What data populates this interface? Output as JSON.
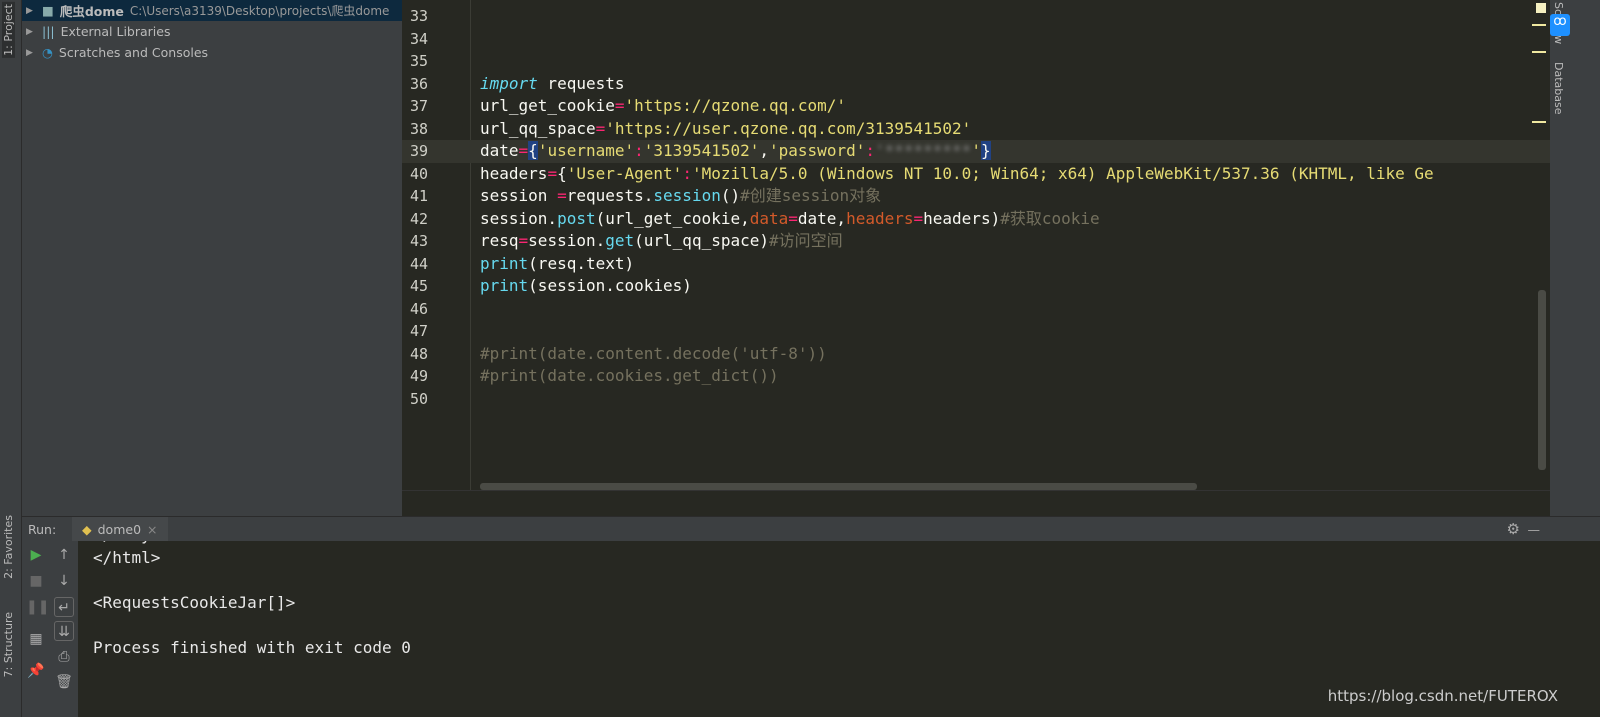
{
  "left_tabs": {
    "project": "1: Project",
    "favorites": "2: Favorites",
    "structure": "7: Structure"
  },
  "project_tree": [
    {
      "name": "爬虫dome",
      "path": "C:\\Users\\a3139\\Desktop\\projects\\爬虫dome",
      "icon": "folder-icon",
      "selected": true
    },
    {
      "name": "External Libraries",
      "icon": "library-icon"
    },
    {
      "name": "Scratches and Consoles",
      "icon": "scratches-icon"
    }
  ],
  "right_tabs": {
    "scview": "SciView",
    "database": "Database"
  },
  "editor": {
    "current_line": 39,
    "lines": [
      {
        "n": "33",
        "t": []
      },
      {
        "n": "34",
        "t": []
      },
      {
        "n": "35",
        "t": []
      },
      {
        "n": "36",
        "t": [
          [
            "import",
            "kw"
          ],
          [
            " requests",
            ""
          ]
        ]
      },
      {
        "n": "37",
        "t": [
          [
            "url_get_cookie",
            ""
          ],
          [
            "=",
            "op"
          ],
          [
            "'https://qzone.qq.com/'",
            "str"
          ]
        ]
      },
      {
        "n": "38",
        "t": [
          [
            "url_qq_space",
            ""
          ],
          [
            "=",
            "op"
          ],
          [
            "'https://user.qzone.qq.com/3139541502'",
            "str"
          ]
        ]
      },
      {
        "n": "39",
        "t": [
          [
            "date",
            ""
          ],
          [
            "=",
            "op"
          ],
          [
            "{",
            "brace"
          ],
          [
            "'username'",
            "str"
          ],
          [
            ":",
            "op"
          ],
          [
            "'3139541502'",
            "str"
          ],
          [
            ",",
            ""
          ],
          [
            "'password'",
            "str"
          ],
          [
            ":",
            "op"
          ],
          [
            "'*********",
            "blur"
          ],
          [
            "'",
            "str"
          ],
          [
            "}",
            "brace"
          ]
        ]
      },
      {
        "n": "40",
        "t": [
          [
            "headers",
            ""
          ],
          [
            "=",
            "op"
          ],
          [
            "{",
            ""
          ],
          [
            "'User-Agent'",
            "str"
          ],
          [
            ":",
            "op"
          ],
          [
            "'Mozilla/5.0 (Windows NT 10.0; Win64; x64) AppleWebKit/537.36 (KHTML, like Ge",
            "str"
          ]
        ]
      },
      {
        "n": "41",
        "t": [
          [
            "session ",
            ""
          ],
          [
            "=",
            "op"
          ],
          [
            "requests.",
            ""
          ],
          [
            "session",
            "fn"
          ],
          [
            "()",
            ""
          ],
          [
            "#创建session对象",
            "cm"
          ]
        ]
      },
      {
        "n": "42",
        "t": [
          [
            "session.",
            ""
          ],
          [
            "post",
            "fn"
          ],
          [
            "(url_get_cookie,",
            ""
          ],
          [
            "data",
            "par"
          ],
          [
            "=",
            "op"
          ],
          [
            "date,",
            ""
          ],
          [
            "headers",
            "par"
          ],
          [
            "=",
            "op"
          ],
          [
            "headers)",
            ""
          ],
          [
            "#获取cookie",
            "cm"
          ]
        ]
      },
      {
        "n": "43",
        "t": [
          [
            "resq",
            ""
          ],
          [
            "=",
            "op"
          ],
          [
            "session.",
            ""
          ],
          [
            "get",
            "fn"
          ],
          [
            "(url_qq_space)",
            ""
          ],
          [
            "#访问空间",
            "cm"
          ]
        ]
      },
      {
        "n": "44",
        "t": [
          [
            "print",
            "fn"
          ],
          [
            "(resq.text)",
            ""
          ]
        ]
      },
      {
        "n": "45",
        "t": [
          [
            "print",
            "fn"
          ],
          [
            "(session.cookies)",
            ""
          ]
        ]
      },
      {
        "n": "46",
        "t": []
      },
      {
        "n": "47",
        "t": []
      },
      {
        "n": "48",
        "t": [
          [
            "#print(date.content.decode('utf-8'))",
            "cm"
          ]
        ]
      },
      {
        "n": "49",
        "t": [
          [
            "#print(date.cookies.get_dict())",
            "cm"
          ]
        ]
      },
      {
        "n": "50",
        "t": []
      }
    ]
  },
  "run": {
    "label": "Run:",
    "tab": "dome0",
    "close": "×",
    "console": [
      "</body>",
      "</html>",
      "",
      "<RequestsCookieJar[]>",
      "",
      "Process finished with exit code 0"
    ]
  },
  "watermark": "https://blog.csdn.net/FUTEROX",
  "colors": {
    "editor_bg": "#272822",
    "panel_bg": "#3c3f41",
    "string": "#e6db74",
    "keyword": "#66d9ef",
    "operator": "#f92672",
    "comment": "#75715e"
  }
}
